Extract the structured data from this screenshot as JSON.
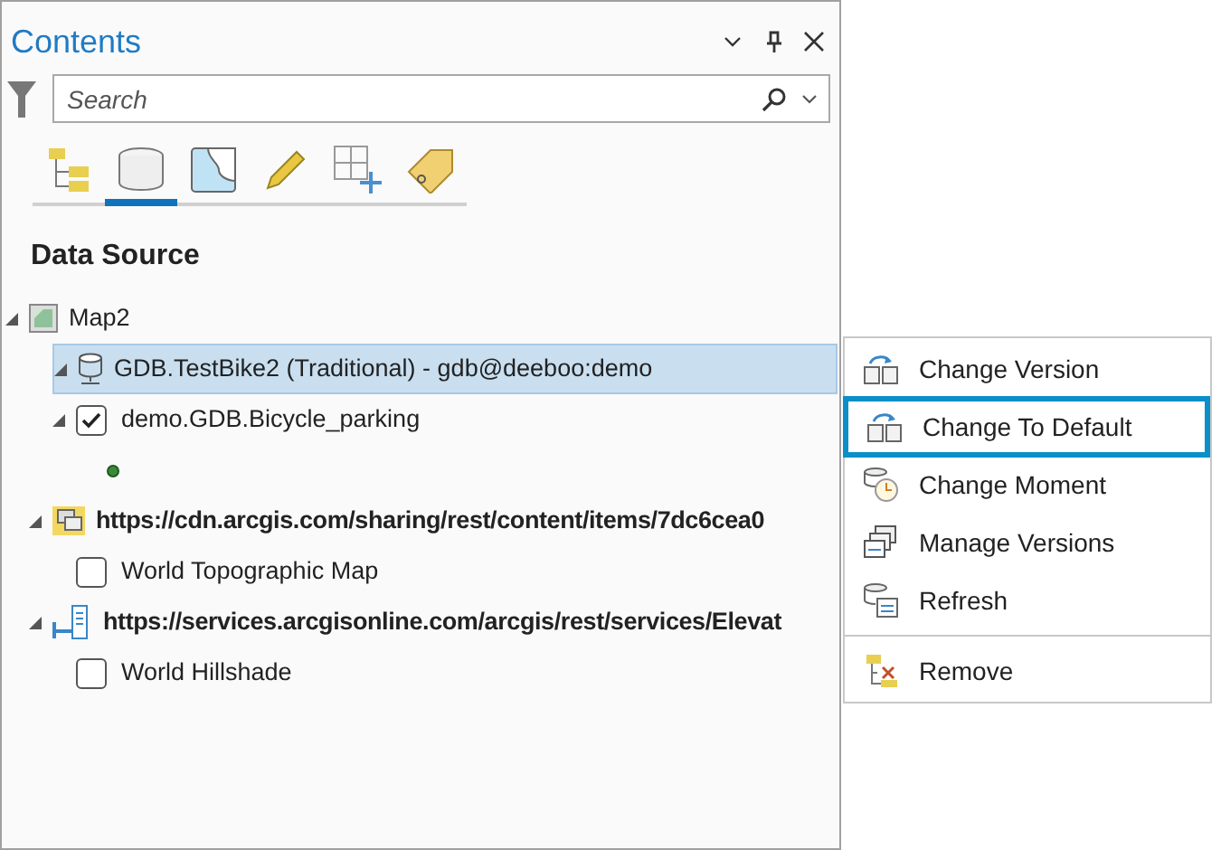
{
  "pane": {
    "title": "Contents",
    "search": {
      "placeholder": "Search"
    },
    "tabs": [
      {
        "kind": "drawing-order",
        "selected": false
      },
      {
        "kind": "data-source",
        "selected": true
      },
      {
        "kind": "selection",
        "selected": false
      },
      {
        "kind": "editing",
        "selected": false
      },
      {
        "kind": "snapping",
        "selected": false
      },
      {
        "kind": "labeling",
        "selected": false
      }
    ],
    "heading": "Data Source",
    "tree": [
      {
        "kind": "map",
        "label": "Map2",
        "expanded": true,
        "selected": false,
        "children": [
          {
            "kind": "database",
            "label": "GDB.TestBike2 (Traditional) - gdb@deeboo:demo",
            "expanded": true,
            "selected": true,
            "children": [
              {
                "kind": "layer",
                "label": "demo.GDB.Bicycle_parking",
                "expanded": true,
                "checked": true,
                "selected": false,
                "children": [
                  {
                    "kind": "symbol",
                    "selected": false
                  }
                ]
              }
            ]
          },
          {
            "kind": "tile-service",
            "label": "https://cdn.arcgis.com/sharing/rest/content/items/7dc6cea0",
            "expanded": true,
            "selected": false,
            "children": [
              {
                "kind": "layer",
                "label": "World Topographic Map",
                "checked": false,
                "selected": false
              }
            ]
          },
          {
            "kind": "elevation-service",
            "label": "https://services.arcgisonline.com/arcgis/rest/services/Elevat",
            "expanded": true,
            "selected": false,
            "children": [
              {
                "kind": "layer",
                "label": "World Hillshade",
                "checked": false,
                "selected": false
              }
            ]
          }
        ]
      }
    ]
  },
  "context_menu": {
    "items": [
      {
        "kind": "version",
        "label": "Change Version",
        "selected": false,
        "separator_before": false
      },
      {
        "kind": "version",
        "label": "Change To Default",
        "selected": true,
        "separator_before": false
      },
      {
        "kind": "moment",
        "label": "Change Moment",
        "selected": false,
        "separator_before": false
      },
      {
        "kind": "manage",
        "label": "Manage Versions",
        "selected": false,
        "separator_before": false
      },
      {
        "kind": "refresh",
        "label": "Refresh",
        "selected": false,
        "separator_before": false
      },
      {
        "kind": "remove",
        "label": "Remove",
        "selected": false,
        "separator_before": true
      }
    ]
  }
}
